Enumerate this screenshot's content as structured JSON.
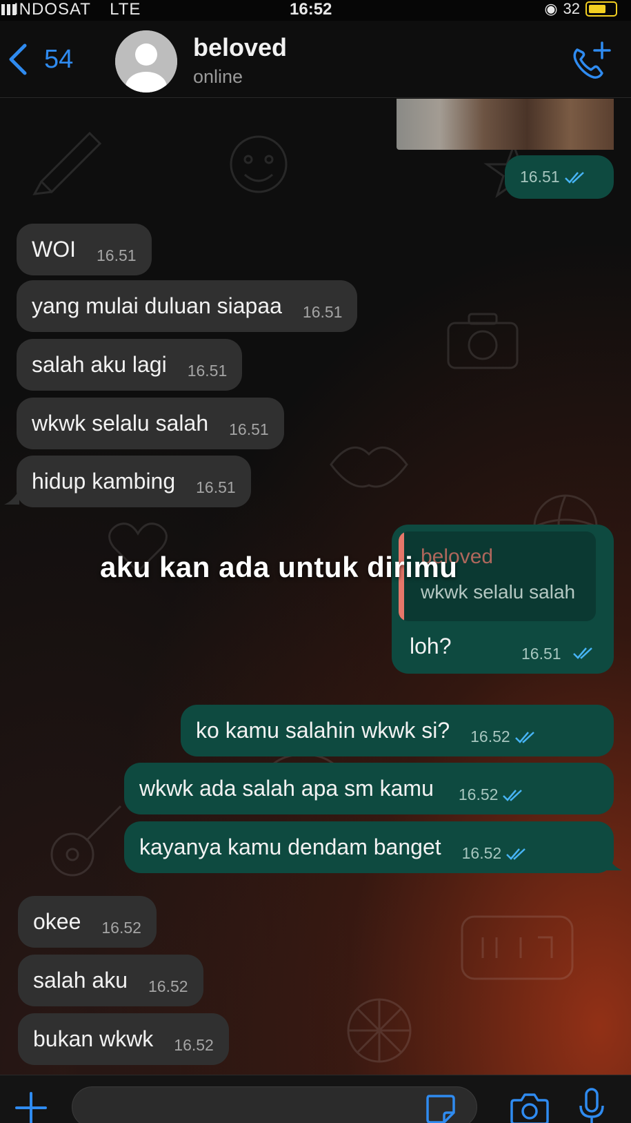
{
  "status_bar": {
    "carrier": "INDOSAT",
    "network": "LTE",
    "time": "16:52",
    "battery_color": "#f3d021"
  },
  "header": {
    "back_count": "54",
    "contact_name": "beloved",
    "contact_status": "online",
    "accent_color": "#2f8bf0"
  },
  "messages": [
    {
      "dir": "out",
      "text": "",
      "time": "16.51",
      "ticks": "read",
      "kind": "photo"
    },
    {
      "dir": "in",
      "text": "WOI",
      "time": "16.51"
    },
    {
      "dir": "in",
      "text": "yang mulai duluan siapaa",
      "time": "16.51"
    },
    {
      "dir": "in",
      "text": "salah aku lagi",
      "time": "16.51"
    },
    {
      "dir": "in",
      "text": "wkwk selalu salah",
      "time": "16.51"
    },
    {
      "dir": "in",
      "text": "hidup kambing",
      "time": "16.51"
    },
    {
      "dir": "out",
      "text": "loh?",
      "time": "16.51",
      "ticks": "read",
      "quote": {
        "author": "beloved",
        "text": "wkwk selalu salah"
      }
    },
    {
      "dir": "out",
      "text": "ko kamu salahin wkwk si?",
      "time": "16.52",
      "ticks": "read"
    },
    {
      "dir": "out",
      "text": "wkwk ada salah apa sm kamu",
      "time": "16.52",
      "ticks": "read"
    },
    {
      "dir": "out",
      "text": "kayanya kamu dendam banget",
      "time": "16.52",
      "ticks": "read"
    },
    {
      "dir": "in",
      "text": "okee",
      "time": "16.52"
    },
    {
      "dir": "in",
      "text": "salah aku",
      "time": "16.52"
    },
    {
      "dir": "in",
      "text": "bukan wkwk",
      "time": "16.52"
    }
  ],
  "overlay_caption": "aku kan ada untuk dirimu",
  "input_bar": {
    "placeholder": "",
    "icons": [
      "plus-icon",
      "sticker-icon",
      "camera-icon",
      "microphone-icon"
    ]
  },
  "colors": {
    "incoming_bubble": "#303030",
    "outgoing_bubble": "#0e4a40",
    "read_ticks": "#47b4f5",
    "quote_accent": "#e6776a"
  }
}
